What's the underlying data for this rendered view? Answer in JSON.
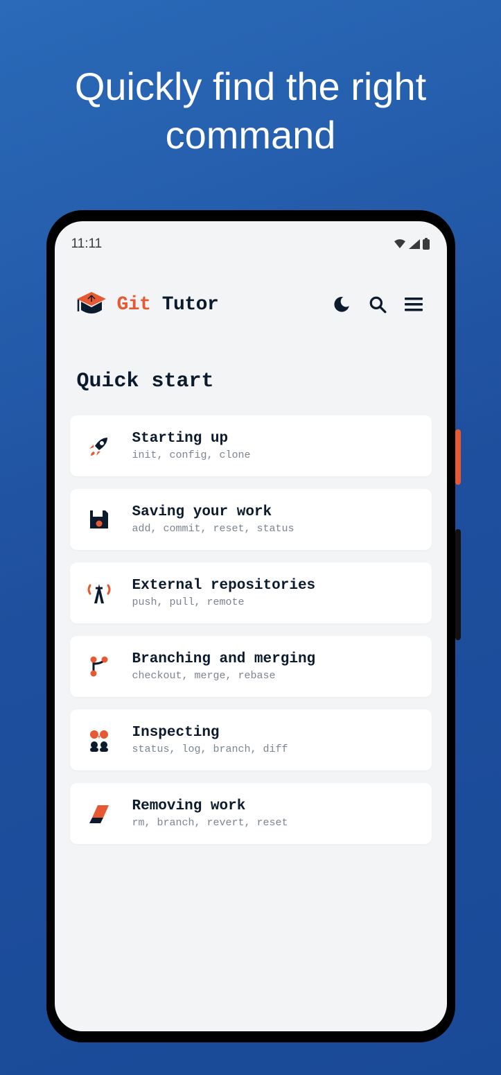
{
  "hero": {
    "title": "Quickly find the right command"
  },
  "status_bar": {
    "time": "11:11"
  },
  "header": {
    "brand_git": "Git",
    "brand_tutor": "Tutor"
  },
  "section_title": "Quick start",
  "cards": [
    {
      "icon": "rocket-icon",
      "title": "Starting up",
      "subtitle": "init, config, clone"
    },
    {
      "icon": "save-icon",
      "title": "Saving your work",
      "subtitle": "add, commit, reset, status"
    },
    {
      "icon": "antenna-icon",
      "title": "External repositories",
      "subtitle": "push, pull, remote"
    },
    {
      "icon": "branch-icon",
      "title": "Branching and merging",
      "subtitle": "checkout, merge, rebase"
    },
    {
      "icon": "inspect-icon",
      "title": "Inspecting",
      "subtitle": "status, log, branch, diff"
    },
    {
      "icon": "erase-icon",
      "title": "Removing work",
      "subtitle": "rm, branch, revert, reset"
    }
  ],
  "colors": {
    "accent": "#e75932",
    "dark": "#0c1a2e"
  }
}
